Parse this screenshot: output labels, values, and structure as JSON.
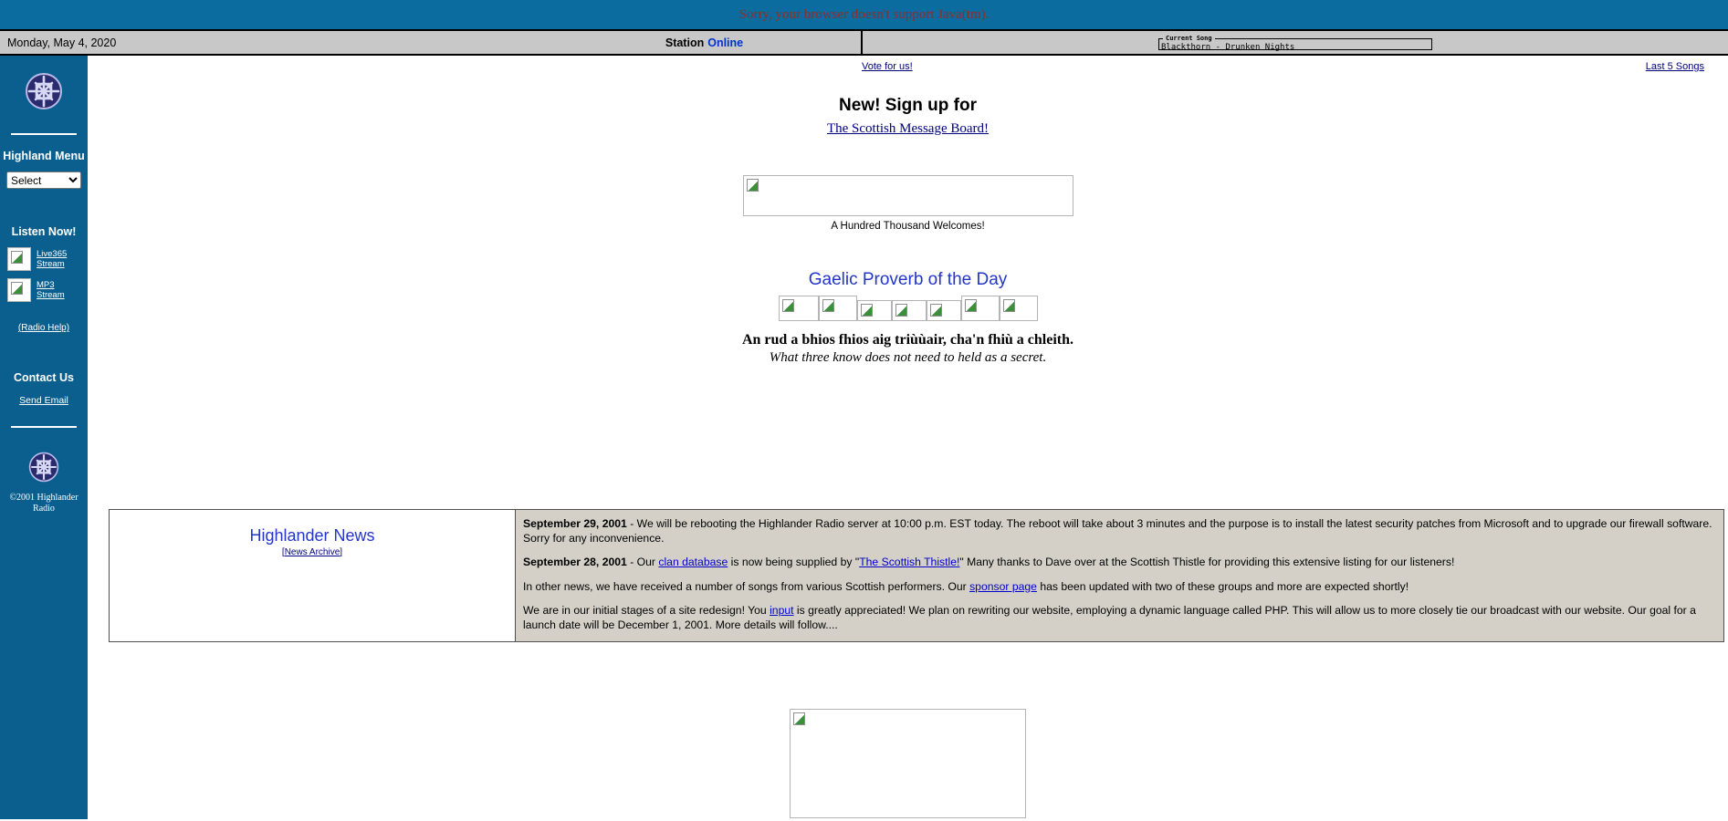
{
  "java_banner": {
    "message": "Sorry, your browser doesn't support Java(tm)."
  },
  "status_bar": {
    "date": "Monday, May 4, 2020",
    "station_label": "Station",
    "station_state": "Online",
    "current_song_legend": "Current Song",
    "current_song_value": "Blackthorn - Drunken Nights"
  },
  "sidebar": {
    "logo_icon": "celtic-knot-icon",
    "menu_heading": "Highland Menu",
    "menu_selected": "Select",
    "menu_options": [
      "Select"
    ],
    "listen_heading": "Listen Now!",
    "streams": [
      {
        "icon": "broken-image-icon",
        "line1": "Live365",
        "line2": "Stream"
      },
      {
        "icon": "broken-image-icon",
        "line1": "MP3",
        "line2": "Stream"
      }
    ],
    "radio_help": "(Radio Help)",
    "contact_heading": "Contact Us",
    "send_email": "Send Email",
    "copyright_line1": "©2001 Highlander",
    "copyright_line2": "Radio"
  },
  "main": {
    "vote_link": "Vote for us!",
    "last5_link": "Last 5 Songs",
    "signup_title": "New! Sign up for",
    "signup_link": "The Scottish Message Board!",
    "welcome_caption": "A Hundred Thousand Welcomes!",
    "welcome_image_icon": "broken-image-icon",
    "proverb_title": "Gaelic Proverb of the Day",
    "proverb_image_icons": [
      "broken-image-icon",
      "broken-image-icon",
      "broken-image-icon",
      "broken-image-icon",
      "broken-image-icon",
      "broken-image-icon",
      "broken-image-icon"
    ],
    "proverb_gaelic": "An rud a bhios fhios aig triùùair, cha'n fhiù a chleith.",
    "proverb_english": "What three know does not need to held as a secret.",
    "bottom_image_icon": "broken-image-icon"
  },
  "news": {
    "title": "Highlander News",
    "archive_label": "[News Archive]",
    "archive_inner": "News Archive",
    "items": [
      {
        "date": "September 29, 2001",
        "dash": " - ",
        "body": "We will be rebooting the Highlander Radio server at 10:00 p.m. EST today. The reboot will take about 3 minutes and the purpose is to install the latest security patches from Microsoft and to upgrade our firewall software. Sorry for any inconvenience."
      }
    ],
    "item2": {
      "date": "September 28, 2001",
      "dash": " - ",
      "part1": "Our ",
      "link1": "clan database",
      "part2": " is now being supplied by \"",
      "link2": "The Scottish Thistle!",
      "part3": "\" Many thanks to Dave over at the Scottish Thistle for providing this extensive listing for our listeners!"
    },
    "item3": {
      "part1": "In other news, we have received a number of songs from various Scottish performers. Our ",
      "link1": "sponsor page",
      "part2": " has been updated with two of these groups and more are expected shortly!"
    },
    "item4": {
      "part1": "We are in our initial stages of a site redesign! You ",
      "link1": "input",
      "part2": " is greatly appreciated! We plan on rewriting our website, employing a dynamic language called PHP. This will allow us to more closely tie our broadcast with our website. Our goal for a launch date will be December 1, 2001. More details will follow...."
    }
  },
  "colors": {
    "sidebar_bg": "#0b5f8f",
    "banner_bg": "#0b6ca0",
    "status_bg": "#c8c8c8",
    "news_bg": "#d4d0c8",
    "link": "#000080",
    "heading_blue": "#2436c8"
  }
}
